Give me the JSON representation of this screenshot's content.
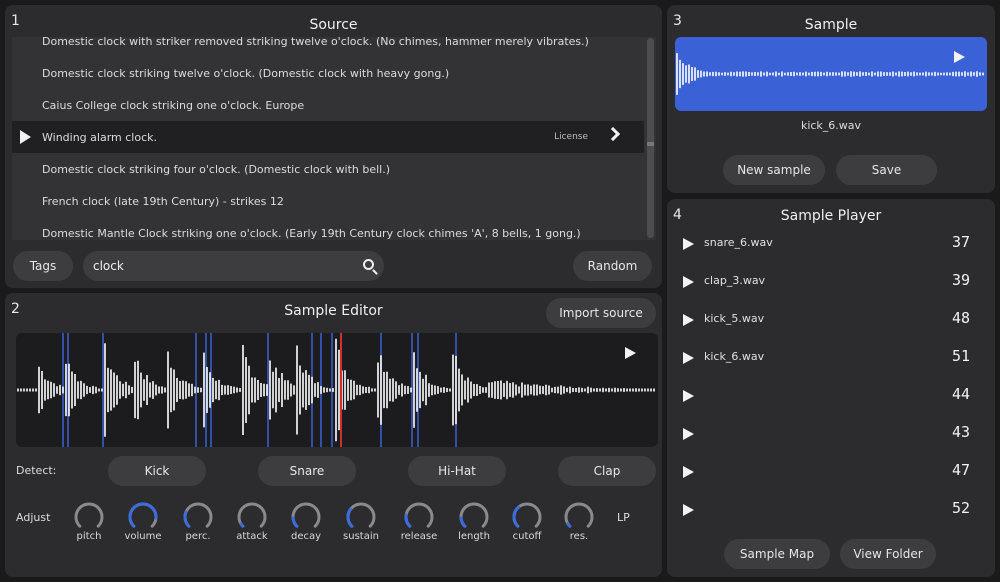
{
  "source": {
    "num": "1",
    "title": "Source",
    "rows": [
      {
        "text": "Domestic clock with striker removed striking twelve o'clock. (No chimes, hammer merely vibrates.)",
        "selected": false
      },
      {
        "text": "Domestic clock striking twelve o'clock. (Domestic clock with heavy gong.)",
        "selected": false
      },
      {
        "text": "Caius College clock striking one o'clock. Europe",
        "selected": false
      },
      {
        "text": "Winding alarm clock.",
        "selected": true,
        "license": "License"
      },
      {
        "text": "Domestic clock striking four o'clock. (Domestic clock with bell.)",
        "selected": false
      },
      {
        "text": "French clock (late 19th Century) - strikes 12",
        "selected": false
      },
      {
        "text": "Domestic Mantle Clock striking one o'clock. (Early 19th Century clock chimes 'A', 8 bells, 1 gong.)",
        "selected": false
      }
    ],
    "tags_label": "Tags",
    "search_value": "clock",
    "random_label": "Random"
  },
  "editor": {
    "num": "2",
    "title": "Sample Editor",
    "import_label": "Import source",
    "detect_label": "Detect:",
    "detect_buttons": [
      "Kick",
      "Snare",
      "Hi-Hat",
      "Clap"
    ],
    "adjust_label": "Adjust",
    "knobs": [
      {
        "label": "pitch",
        "value": 0.0
      },
      {
        "label": "volume",
        "value": 0.85
      },
      {
        "label": "perc.",
        "value": 0.25
      },
      {
        "label": "attack",
        "value": 0.05
      },
      {
        "label": "decay",
        "value": 0.15
      },
      {
        "label": "sustain",
        "value": 0.3
      },
      {
        "label": "release",
        "value": 0.2
      },
      {
        "label": "length",
        "value": 0.15
      },
      {
        "label": "cutoff",
        "value": 0.35
      },
      {
        "label": "res.",
        "value": 0.05
      }
    ],
    "filter_label": "LP"
  },
  "sample": {
    "num": "3",
    "title": "Sample",
    "filename": "kick_6.wav",
    "new_label": "New sample",
    "save_label": "Save"
  },
  "player": {
    "num": "4",
    "title": "Sample Player",
    "rows": [
      {
        "file": "snare_6.wav",
        "value": "37"
      },
      {
        "file": "clap_3.wav",
        "value": "39"
      },
      {
        "file": "kick_5.wav",
        "value": "48"
      },
      {
        "file": "kick_6.wav",
        "value": "51"
      },
      {
        "file": "",
        "value": "44"
      },
      {
        "file": "",
        "value": "43"
      },
      {
        "file": "",
        "value": "47"
      },
      {
        "file": "",
        "value": "52"
      }
    ],
    "map_label": "Sample Map",
    "folder_label": "View Folder"
  },
  "colors": {
    "accent": "#3b61d6",
    "knob_arc": "#3b6de0",
    "playhead": "#d03030"
  }
}
